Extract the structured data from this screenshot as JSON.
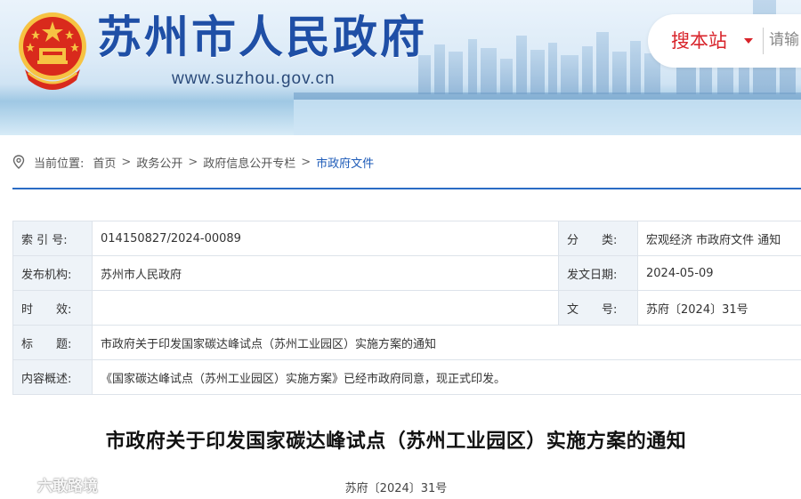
{
  "header": {
    "site_title": "苏州市人民政府",
    "site_url": "www.suzhou.gov.cn",
    "search_scope": "搜本站",
    "search_placeholder": "请输",
    "emblem_icon": "national-emblem-icon",
    "colors": {
      "title": "#1f4fa6",
      "search_scope": "#d8232a"
    }
  },
  "breadcrumb": {
    "label": "当前位置:",
    "icon": "location-pin-icon",
    "items": [
      "首页",
      "政务公开",
      "政府信息公开专栏",
      "市政府文件"
    ],
    "separator": ">"
  },
  "info_table": {
    "rows": [
      {
        "k1": "索 引 号:",
        "v1": "014150827/2024-00089",
        "k2": "分　　类:",
        "v2": "宏观经济 市政府文件 通知"
      },
      {
        "k1": "发布机构:",
        "v1": "苏州市人民政府",
        "k2": "发文日期:",
        "v2": "2024-05-09"
      },
      {
        "k1": "时　　效:",
        "v1": "",
        "k2": "文　　号:",
        "v2": "苏府〔2024〕31号"
      }
    ],
    "title_row": {
      "k": "标　　题:",
      "v": "市政府关于印发国家碳达峰试点（苏州工业园区）实施方案的通知"
    },
    "summary_row": {
      "k": "内容概述:",
      "v": "《国家碳达峰试点（苏州工业园区）实施方案》已经市政府同意，现正式印发。"
    }
  },
  "article": {
    "title": "市政府关于印发国家碳达峰试点（苏州工业园区）实施方案的通知",
    "doc_number": "苏府〔2024〕31号"
  },
  "watermark": {
    "text": "六敢路境"
  }
}
